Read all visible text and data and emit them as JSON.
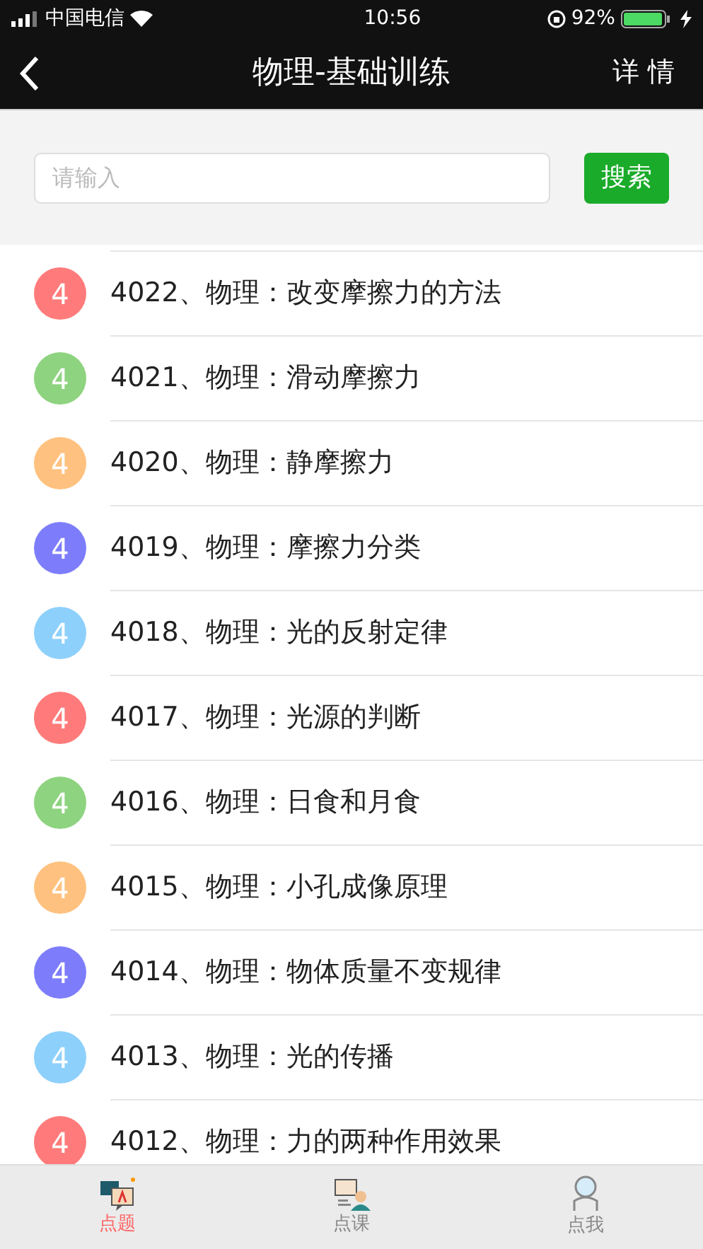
{
  "status_bar": {
    "carrier": "中国电信",
    "time": "10:56",
    "battery": "92%"
  },
  "nav": {
    "title": "物理-基础训练",
    "action": "详 情"
  },
  "search": {
    "placeholder": "请输入",
    "button": "搜索"
  },
  "items": [
    {
      "badge": "4",
      "color": "#ff7b7b",
      "text": "4022、物理：改变摩擦力的方法"
    },
    {
      "badge": "4",
      "color": "#8ed37f",
      "text": "4021、物理：滑动摩擦力"
    },
    {
      "badge": "4",
      "color": "#ffc17f",
      "text": "4020、物理：静摩擦力"
    },
    {
      "badge": "4",
      "color": "#7d7dfc",
      "text": "4019、物理：摩擦力分类"
    },
    {
      "badge": "4",
      "color": "#8ed0fc",
      "text": "4018、物理：光的反射定律"
    },
    {
      "badge": "4",
      "color": "#ff7b7b",
      "text": "4017、物理：光源的判断"
    },
    {
      "badge": "4",
      "color": "#8ed37f",
      "text": "4016、物理：日食和月食"
    },
    {
      "badge": "4",
      "color": "#ffc17f",
      "text": "4015、物理：小孔成像原理"
    },
    {
      "badge": "4",
      "color": "#7d7dfc",
      "text": "4014、物理：物体质量不变规律"
    },
    {
      "badge": "4",
      "color": "#8ed0fc",
      "text": "4013、物理：光的传播"
    },
    {
      "badge": "4",
      "color": "#ff7b7b",
      "text": "4012、物理：力的两种作用效果"
    }
  ],
  "tabs": [
    {
      "label": "点题",
      "selected": true,
      "kind": "quiz"
    },
    {
      "label": "点课",
      "selected": false,
      "kind": "lesson"
    },
    {
      "label": "点我",
      "selected": false,
      "kind": "me"
    }
  ]
}
